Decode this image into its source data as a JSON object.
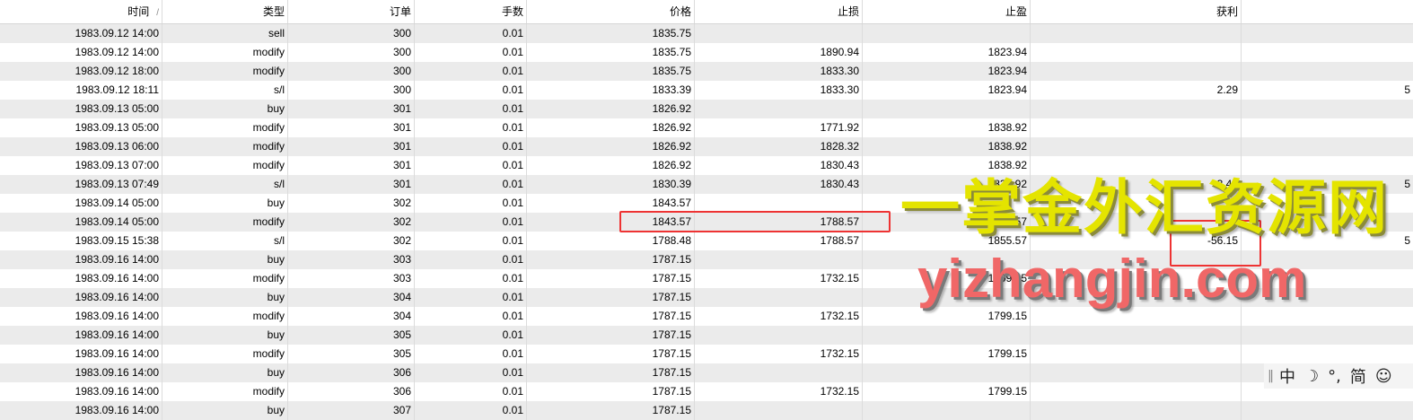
{
  "columns": [
    "时间",
    "类型",
    "订单",
    "手数",
    "价格",
    "止损",
    "止盈",
    "获利",
    ""
  ],
  "rows": [
    [
      "1983.09.12 14:00",
      "sell",
      "300",
      "0.01",
      "1835.75",
      "",
      "",
      "",
      ""
    ],
    [
      "1983.09.12 14:00",
      "modify",
      "300",
      "0.01",
      "1835.75",
      "1890.94",
      "1823.94",
      "",
      ""
    ],
    [
      "1983.09.12 18:00",
      "modify",
      "300",
      "0.01",
      "1835.75",
      "1833.30",
      "1823.94",
      "",
      ""
    ],
    [
      "1983.09.12 18:11",
      "s/l",
      "300",
      "0.01",
      "1833.39",
      "1833.30",
      "1823.94",
      "2.29",
      "5"
    ],
    [
      "1983.09.13 05:00",
      "buy",
      "301",
      "0.01",
      "1826.92",
      "",
      "",
      "",
      ""
    ],
    [
      "1983.09.13 05:00",
      "modify",
      "301",
      "0.01",
      "1826.92",
      "1771.92",
      "1838.92",
      "",
      ""
    ],
    [
      "1983.09.13 06:00",
      "modify",
      "301",
      "0.01",
      "1826.92",
      "1828.32",
      "1838.92",
      "",
      ""
    ],
    [
      "1983.09.13 07:00",
      "modify",
      "301",
      "0.01",
      "1826.92",
      "1830.43",
      "1838.92",
      "",
      ""
    ],
    [
      "1983.09.13 07:49",
      "s/l",
      "301",
      "0.01",
      "1830.39",
      "1830.43",
      "1838.92",
      "3.40",
      "5"
    ],
    [
      "1983.09.14 05:00",
      "buy",
      "302",
      "0.01",
      "1843.57",
      "",
      "",
      "",
      ""
    ],
    [
      "1983.09.14 05:00",
      "modify",
      "302",
      "0.01",
      "1843.57",
      "1788.57",
      "1855.57",
      "",
      ""
    ],
    [
      "1983.09.15 15:38",
      "s/l",
      "302",
      "0.01",
      "1788.48",
      "1788.57",
      "1855.57",
      "-56.15",
      "5"
    ],
    [
      "1983.09.16 14:00",
      "buy",
      "303",
      "0.01",
      "1787.15",
      "",
      "",
      "",
      ""
    ],
    [
      "1983.09.16 14:00",
      "modify",
      "303",
      "0.01",
      "1787.15",
      "1732.15",
      "1799.15",
      "",
      ""
    ],
    [
      "1983.09.16 14:00",
      "buy",
      "304",
      "0.01",
      "1787.15",
      "",
      "",
      "",
      ""
    ],
    [
      "1983.09.16 14:00",
      "modify",
      "304",
      "0.01",
      "1787.15",
      "1732.15",
      "1799.15",
      "",
      ""
    ],
    [
      "1983.09.16 14:00",
      "buy",
      "305",
      "0.01",
      "1787.15",
      "",
      "",
      "",
      ""
    ],
    [
      "1983.09.16 14:00",
      "modify",
      "305",
      "0.01",
      "1787.15",
      "1732.15",
      "1799.15",
      "",
      ""
    ],
    [
      "1983.09.16 14:00",
      "buy",
      "306",
      "0.01",
      "1787.15",
      "",
      "",
      "",
      ""
    ],
    [
      "1983.09.16 14:00",
      "modify",
      "306",
      "0.01",
      "1787.15",
      "1732.15",
      "1799.15",
      "",
      ""
    ],
    [
      "1983.09.16 14:00",
      "buy",
      "307",
      "0.01",
      "1787.15",
      "",
      "",
      "",
      ""
    ]
  ],
  "sort_indicator": "/",
  "watermark": {
    "cn": "一掌金外汇资源网",
    "en": "yizhangjin.com"
  },
  "ime": {
    "mode": "中",
    "moon": "☽",
    "punct": "°,",
    "script": "简",
    "emoji": "☺"
  },
  "colors": {
    "highlight": "#e33333",
    "row_alt": "#ebebeb"
  }
}
